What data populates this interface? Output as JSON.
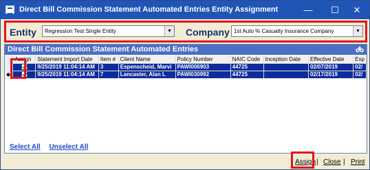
{
  "window": {
    "title": "Direct Bill Commission Statement Automated Entries Entity Assignment",
    "minimize": "—",
    "maximize": "☐",
    "close": "✕"
  },
  "entity": {
    "label": "Entity",
    "value": "Regression Test  Single Entity"
  },
  "company": {
    "label": "Company",
    "value": "1st Auto % Casualty Insurance Company"
  },
  "panel": {
    "title": "Direct Bill Commission Statement Automated Entries"
  },
  "grid": {
    "columns": [
      "Assign",
      "Statement Import Date",
      "Item #",
      "Client Name",
      "Policy Number",
      "NAIC Code",
      "Inception Date",
      "Effective Date",
      "Exp"
    ],
    "rows": [
      {
        "indicator": "",
        "assign": true,
        "import_date": "9/25/2019 11:04:14 AM",
        "item": "3",
        "client": "Espenscheid, Marvi",
        "policy": "PAWI006903",
        "naic": "44725",
        "inception": "",
        "effective": "02/07/2019",
        "exp": "02/"
      },
      {
        "indicator": "◆",
        "assign": true,
        "import_date": "9/25/2019 11:04:14 AM",
        "item": "7",
        "client": "Lancaster, Alan L",
        "policy": "PAWI030992",
        "naic": "44725",
        "inception": "",
        "effective": "02/17/2019",
        "exp": "02/"
      }
    ]
  },
  "links": {
    "select_all": "Select All",
    "unselect_all": "Unselect All"
  },
  "footer": {
    "assign": "Assign",
    "close": "Close",
    "print": "Print",
    "separator": "|"
  },
  "colors": {
    "titlebar": "#2055b8",
    "highlight": "#e1141f",
    "selected_row": "#0e2c9a",
    "panel_header": "#4a6fc4"
  }
}
